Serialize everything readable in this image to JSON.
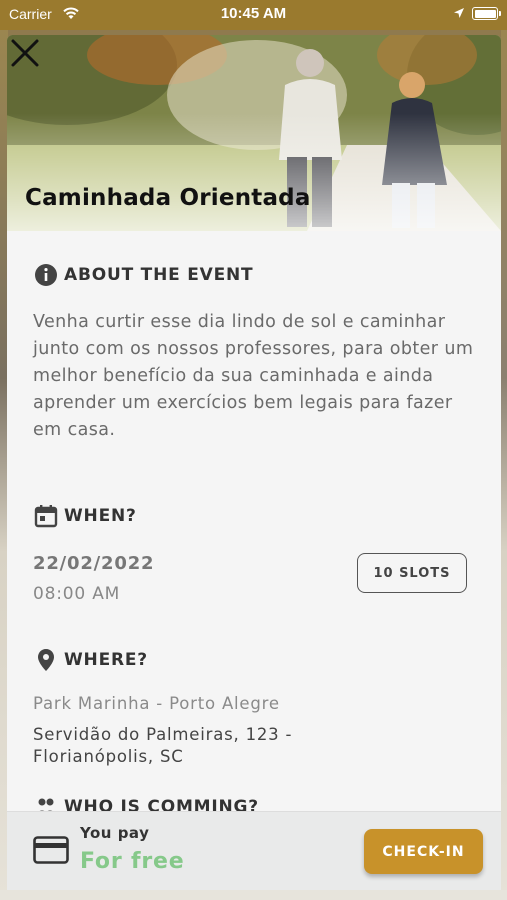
{
  "status_bar": {
    "carrier": "Carrier",
    "time": "10:45 AM"
  },
  "event": {
    "title": "Caminhada Orientada",
    "close_icon": "close-icon"
  },
  "about": {
    "heading": "ABOUT THE EVENT",
    "icon": "info-icon",
    "text": "Venha curtir esse dia lindo de sol e caminhar junto com os nossos professores, para obter um melhor benefício da sua caminhada e ainda aprender um exercícios bem legais para fazer em casa."
  },
  "when": {
    "heading": "WHEN?",
    "icon": "calendar-icon",
    "date": "22/02/2022",
    "time": "08:00 AM",
    "slots": "10 SLOTS"
  },
  "where": {
    "heading": "WHERE?",
    "icon": "location-pin-icon",
    "place": "Park Marinha - Porto Alegre",
    "address": "Servidão do Palmeiras, 123 - Florianópolis, SC"
  },
  "who": {
    "heading": "WHO IS COMMING?",
    "icon": "people-icon"
  },
  "footer": {
    "icon": "credit-card-icon",
    "you_pay_label": "You pay",
    "price": "For free",
    "checkin_label": "CHECK-IN"
  },
  "colors": {
    "status_bar": "#9a7a2e",
    "accent_button": "#c8922a",
    "price_green": "#86c98a"
  }
}
